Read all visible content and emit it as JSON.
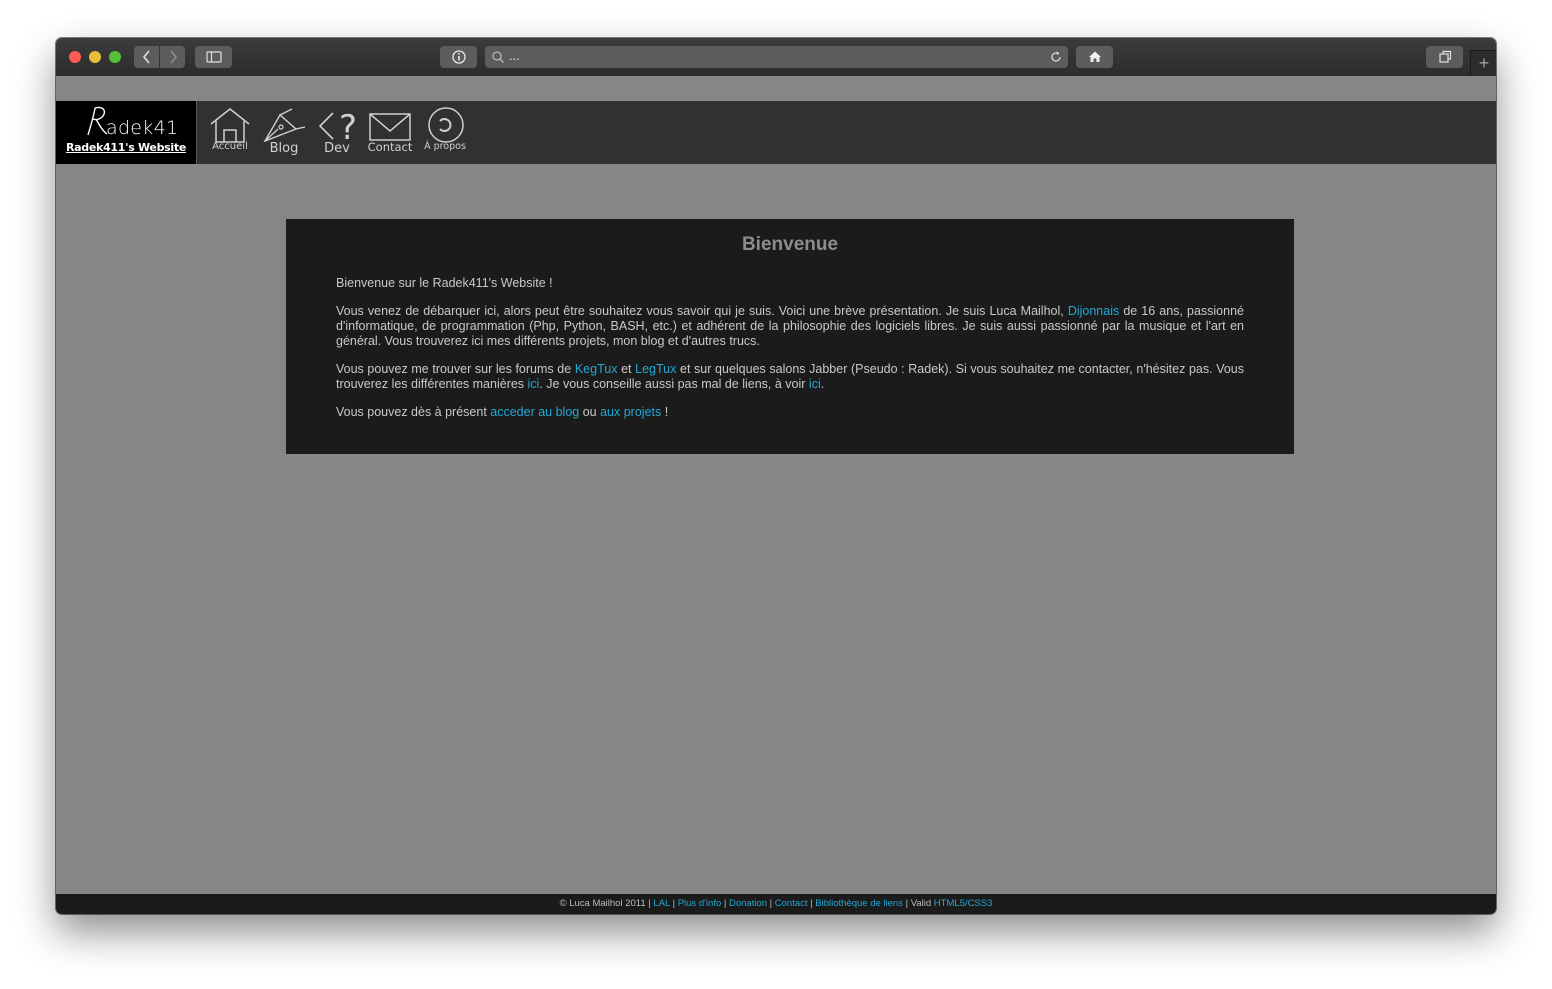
{
  "browser": {
    "url_text": "...",
    "new_tab_label": "+"
  },
  "site": {
    "logo_caption": "Radek411's Website",
    "nav": [
      {
        "label": "Accueil",
        "icon": "home-icon"
      },
      {
        "label": "Blog",
        "icon": "pen-nib-icon"
      },
      {
        "label": "Dev",
        "icon": "chevron-question-icon"
      },
      {
        "label": "Contact",
        "icon": "envelope-icon"
      },
      {
        "label": "À propos",
        "icon": "circle-c-icon"
      }
    ]
  },
  "panel": {
    "title": "Bienvenue",
    "p1": "Bienvenue sur le Radek411's Website !",
    "p2": {
      "a": "Vous venez de débarquer ici, alors peut être souhaitez vous savoir qui je suis. Voici une brève présentation. Je suis Luca Mailhol, ",
      "link": "Dijonnais",
      "b": " de 16 ans, passionné d'informatique, de programmation (Php, Python, BASH, etc.) et adhérent de la philosophie des logiciels libres. Je suis aussi passionné par la musique et l'art en général. Vous trouverez ici mes différents projets, mon blog et d'autres trucs."
    },
    "p3": {
      "a": "Vous pouvez me trouver sur les forums de ",
      "link1": "KegTux",
      "b": " et ",
      "link2": "LegTux",
      "c": " et sur quelques salons Jabber (Pseudo : Radek). Si vous souhaitez me contacter, n'hésitez pas. Vous trouverez les différentes manières ",
      "link3": "ici",
      "d": ". Je vous conseille aussi pas mal de liens, à voir ",
      "link4": "ici",
      "e": "."
    },
    "p4": {
      "a": "Vous pouvez dès à présent ",
      "link1": "acceder au blog",
      "b": " ou ",
      "link2": "aux projets",
      "c": " !"
    }
  },
  "footer": {
    "copyright": "© Luca Mailhol 2011 | ",
    "links": [
      "LAL",
      "Plus d'info",
      "Donation",
      "Contact",
      "Bibliothèque de liens"
    ],
    "sep": " | ",
    "valid_prefix": " | Valid ",
    "valid_link": "HTML5/CSS3"
  },
  "colors": {
    "link": "#23a8d4",
    "page_bg": "#868686",
    "panel_bg": "#1b1b1b",
    "header_bg": "#313131"
  }
}
